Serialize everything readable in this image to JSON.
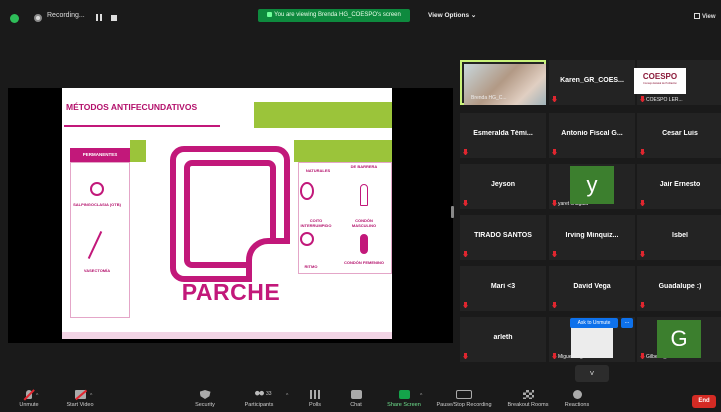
{
  "top_bar": {
    "recording_label": "Recording...",
    "share_banner": "You are viewing Brenda HG_COESPO's screen",
    "view_options_label": "View Options",
    "view_label": "View",
    "colors": {
      "banner_green": "#0e8a3e",
      "shield_green": "#2ebd59"
    }
  },
  "slide": {
    "title": "MÉTODOS ANTIFECUNDATIVOS",
    "permanent_header": "PERMANENTES",
    "label_salpingo": "SALPINGOCLASIA (OTB)",
    "label_vasectomy": "VASECTOMÍA",
    "label_naturales": "NATURALES",
    "label_barrera": "DE BARRERA",
    "label_coito": "COITO INTERRUMPIDO",
    "label_condon_m": "CONDÓN MASCULINO",
    "label_ritmo": "RITMO",
    "label_condon_f": "CONDÓN FEMENINO",
    "method_name": "PARCHE",
    "colors": {
      "magenta": "#c2187a",
      "green": "#9bc43a"
    }
  },
  "gallery": {
    "tiles": [
      {
        "name": "Brenda HG_C...",
        "type": "video"
      },
      {
        "name": "Karen_GR_COES...",
        "type": "name"
      },
      {
        "name": "COESPO LER...",
        "type": "logo",
        "logo_text": "COESPO",
        "logo_sub": "Consejo Estatal de Población"
      },
      {
        "name": "Esmeralda Témi...",
        "type": "name"
      },
      {
        "name": "Antonio Fiscal G...",
        "type": "name"
      },
      {
        "name": "Cesar Luis",
        "type": "name"
      },
      {
        "name": "Jeyson",
        "type": "name"
      },
      {
        "name": "yaret chagala",
        "type": "avatar",
        "initial": "y"
      },
      {
        "name": "Jair Ernesto",
        "type": "name"
      },
      {
        "name": "TIRADO SANTOS",
        "type": "name"
      },
      {
        "name": "Irving Minquiz...",
        "type": "name"
      },
      {
        "name": "Isbel",
        "type": "name"
      },
      {
        "name": "Mari <3",
        "type": "name"
      },
      {
        "name": "David Vega",
        "type": "name"
      },
      {
        "name": "Guadalupe :)",
        "type": "name"
      },
      {
        "name": "arleth",
        "type": "name"
      },
      {
        "name": "Miguel Angel...",
        "type": "photo"
      },
      {
        "name": "Gilberto_Xol...",
        "type": "avatar",
        "initial": "G"
      }
    ],
    "ask_to_unmute": "Ask to Unmute",
    "more_label": "...",
    "page_down": "˅"
  },
  "toolbar": {
    "unmute": "Unmute",
    "start_video": "Start Video",
    "security": "Security",
    "participants": "Participants",
    "participants_count": "33",
    "polls": "Polls",
    "chat": "Chat",
    "share_screen": "Share Screen",
    "recording": "Pause/Stop Recording",
    "breakout": "Breakout Rooms",
    "reactions": "Reactions",
    "end": "End"
  }
}
